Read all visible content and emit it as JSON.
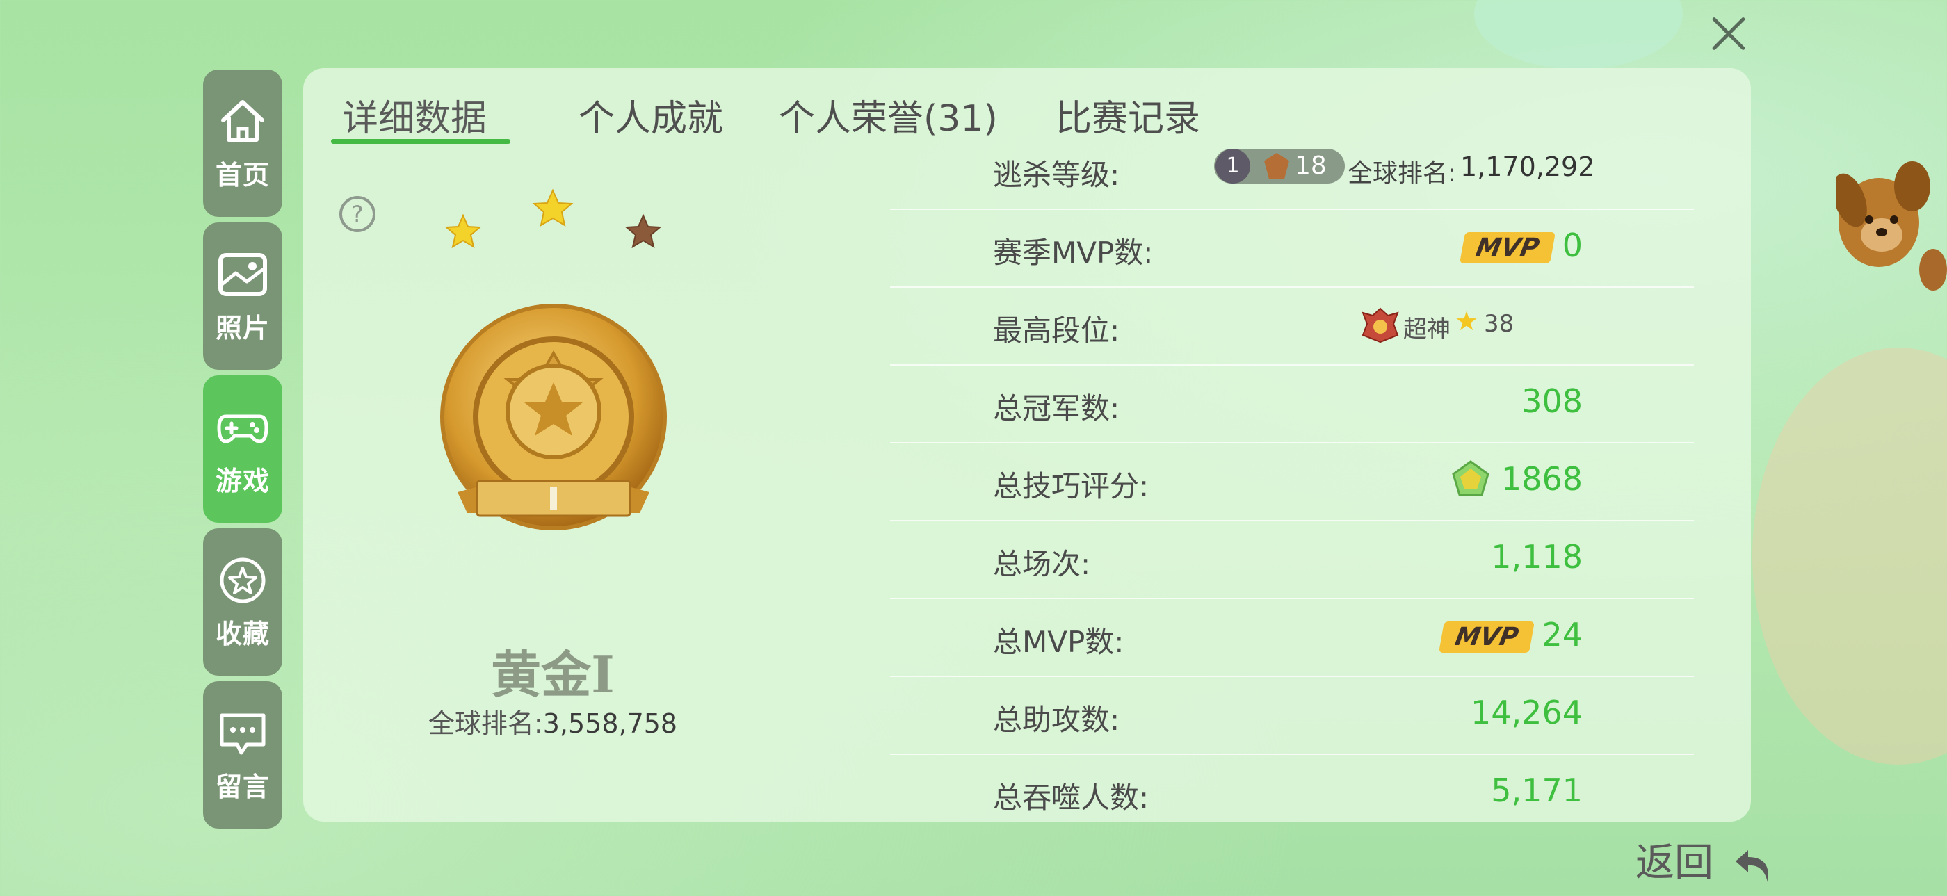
{
  "tabs": [
    {
      "label": "详细数据"
    },
    {
      "label": "个人成就"
    },
    {
      "label": "个人荣誉(31)"
    },
    {
      "label": "比赛记录"
    }
  ],
  "sidebar": {
    "items": [
      {
        "label": "首页",
        "icon": "home-icon"
      },
      {
        "label": "照片",
        "icon": "photo-icon"
      },
      {
        "label": "游戏",
        "icon": "gamepad-icon"
      },
      {
        "label": "收藏",
        "icon": "favorite-icon"
      },
      {
        "label": "留言",
        "icon": "message-icon"
      }
    ],
    "active_index": 2
  },
  "rank": {
    "name": "黄金Ⅰ",
    "global_label": "全球排名:",
    "global_value": "3,558,758",
    "stars_filled": 2,
    "stars_total": 3
  },
  "stats": {
    "escape_level": {
      "label": "逃杀等级:",
      "level": "18",
      "level_prefix": "1",
      "global_label": "全球排名:",
      "global_value": "1,170,292"
    },
    "season_mvp": {
      "label": "赛季MVP数:",
      "badge": "MVP",
      "value": "0"
    },
    "highest_tier": {
      "label": "最高段位:",
      "tier_name": "超神",
      "stars": "38"
    },
    "total_champions": {
      "label": "总冠军数:",
      "value": "308"
    },
    "total_skill": {
      "label": "总技巧评分:",
      "value": "1868"
    },
    "total_matches": {
      "label": "总场次:",
      "value": "1,118"
    },
    "total_mvp": {
      "label": "总MVP数:",
      "badge": "MVP",
      "value": "24"
    },
    "total_assists": {
      "label": "总助攻数:",
      "value": "14,264"
    },
    "total_devour": {
      "label": "总吞噬人数:",
      "value": "5,171"
    }
  },
  "back_label": "返回",
  "colors": {
    "accent_green": "#3fbf3f",
    "sidebar_active": "#5cc65c",
    "sidebar_bg": "#7a9575",
    "mvp_badge": "#f5c235"
  }
}
